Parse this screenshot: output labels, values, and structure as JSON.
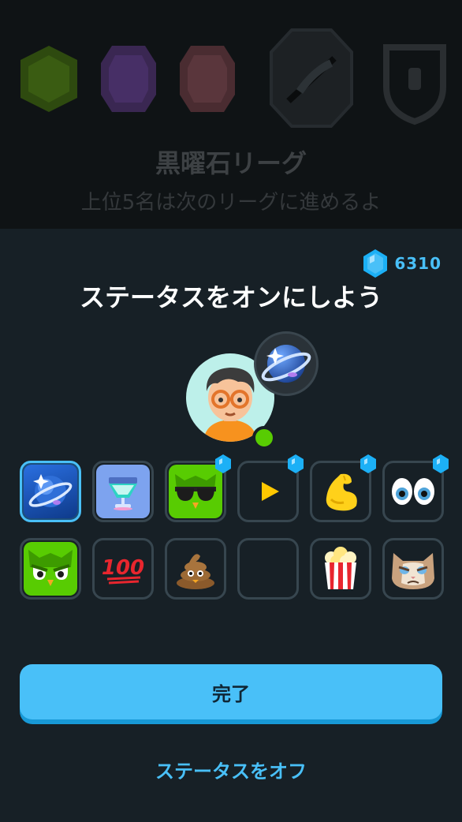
{
  "background": {
    "league_title": "黒曜石リーグ",
    "league_subtitle": "上位5名は次のリーグに進めるよ",
    "league_icons": [
      "emerald-league-icon",
      "amethyst-league-icon",
      "pearl-league-icon",
      "obsidian-league-icon",
      "locked-league-icon"
    ]
  },
  "sheet": {
    "gem_count": "6310",
    "title": "ステータスをオンにしよう",
    "statuses": [
      {
        "name": "planet-status",
        "selected": true,
        "premium": false
      },
      {
        "name": "trophy-cup-status",
        "selected": false,
        "premium": false
      },
      {
        "name": "cool-owl-status",
        "selected": false,
        "premium": true
      },
      {
        "name": "play-status",
        "selected": false,
        "premium": true
      },
      {
        "name": "flexed-bicep-status",
        "selected": false,
        "premium": true
      },
      {
        "name": "eyes-status",
        "selected": false,
        "premium": true
      },
      {
        "name": "angry-owl-status",
        "selected": false,
        "premium": false
      },
      {
        "name": "hundred-points-status",
        "selected": false,
        "premium": false
      },
      {
        "name": "poop-status",
        "selected": false,
        "premium": false
      },
      {
        "name": "empty-status",
        "selected": false,
        "premium": false
      },
      {
        "name": "popcorn-status",
        "selected": false,
        "premium": false
      },
      {
        "name": "grumpy-cat-status",
        "selected": false,
        "premium": false
      }
    ],
    "done_label": "完了",
    "off_label": "ステータスをオフ"
  },
  "colors": {
    "accent": "#49c0f8",
    "sheet_bg": "#172026",
    "tile_border": "#37464f",
    "online": "#58cc02"
  }
}
